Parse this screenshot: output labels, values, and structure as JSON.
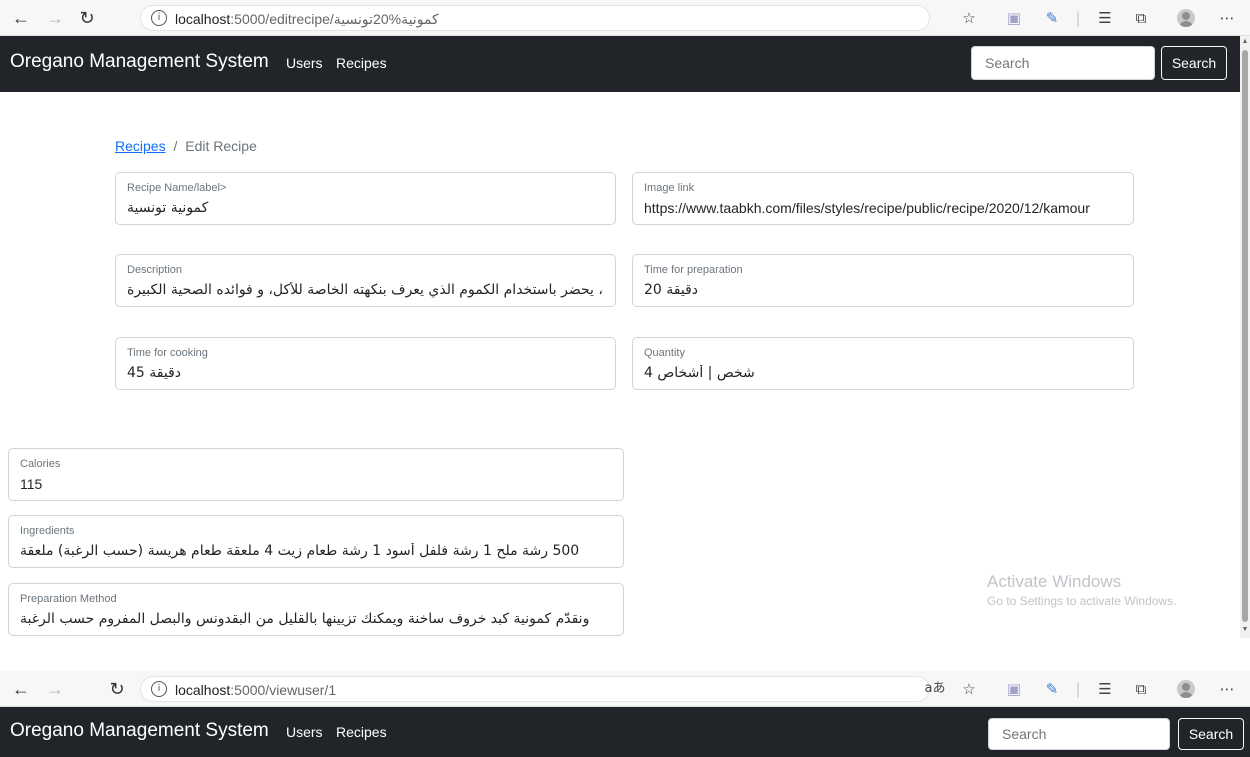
{
  "window1": {
    "url_host": "localhost",
    "url_path": ":5000/editrecipe/كمونية%20تونسية"
  },
  "window2": {
    "url_host": "localhost",
    "url_path": ":5000/viewuser/1",
    "read_aloud_icon": "aあ"
  },
  "navbar": {
    "brand": "Oregano Management System",
    "links": [
      "Users",
      "Recipes"
    ],
    "search_placeholder": "Search",
    "search_button": "Search"
  },
  "breadcrumb": {
    "link": "Recipes",
    "separator": "/",
    "current": "Edit Recipe"
  },
  "form": {
    "recipe_name": {
      "label": "Recipe Name/label>",
      "value": "كمونية تونسية"
    },
    "image_link": {
      "label": "Image link",
      "value": "https://www.taabkh.com/files/styles/recipe/public/recipe/2020/12/kamour"
    },
    "description": {
      "label": "Description",
      "value": "، يحضر باستخدام الكموم الذي يعرف بنكهته الخاصة للأكل، و فوائده الصحية الكبيرة"
    },
    "time_preparation": {
      "label": "Time for preparation",
      "value": "20 دقيقة"
    },
    "time_cooking": {
      "label": "Time for cooking",
      "value": "45 دقيقة"
    },
    "quantity": {
      "label": "Quantity",
      "value": "4 شخص | أشخاص"
    },
    "calories": {
      "label": "Calories",
      "value": "115"
    },
    "ingredients": {
      "label": "Ingredients",
      "value": "500 رشة ملح   1 رشة فلفل أسود   1 رشة طعام زيت   4 ملعقة طعام هريسة (حسب الرغبة)   ملعقة"
    },
    "preparation_method": {
      "label": "Preparation Method",
      "value": "ونقدّم كمونية كبد خروف ساخنة ويمكنك تزيينها بالقليل من البقدونس والبصل المفروم حسب الرغبة"
    }
  },
  "watermark": {
    "title": "Activate Windows",
    "subtitle": "Go to Settings to activate Windows."
  }
}
